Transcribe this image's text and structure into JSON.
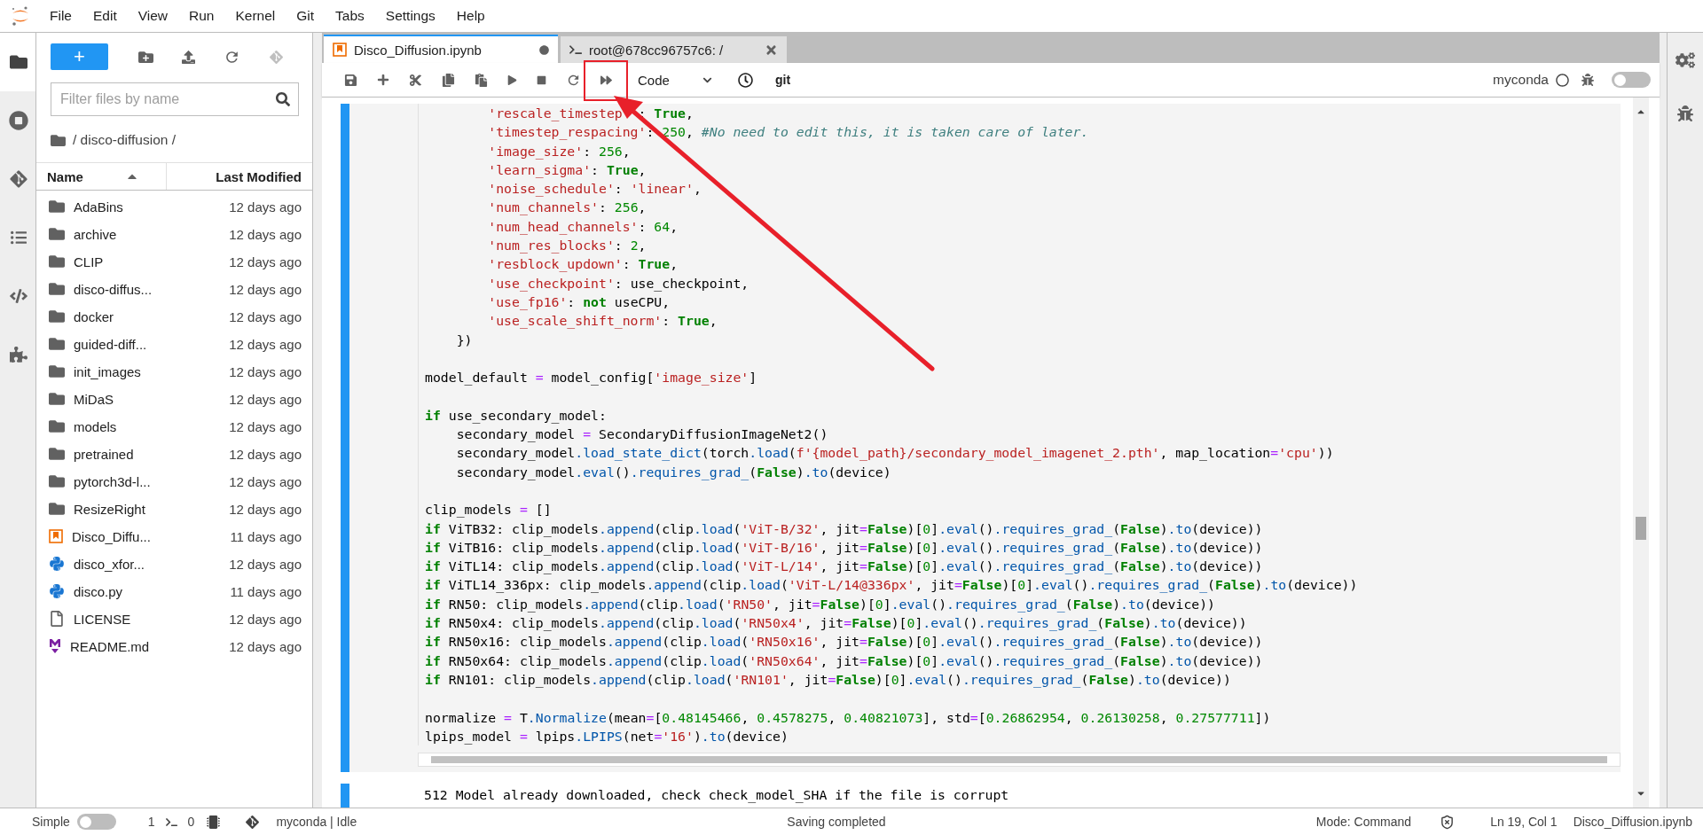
{
  "menu": [
    "File",
    "Edit",
    "View",
    "Run",
    "Kernel",
    "Git",
    "Tabs",
    "Settings",
    "Help"
  ],
  "left_rail": [
    {
      "kind": "files",
      "selected": true
    },
    {
      "kind": "running",
      "selected": false
    },
    {
      "kind": "git",
      "selected": false
    },
    {
      "kind": "toc",
      "selected": false
    },
    {
      "kind": "snippets",
      "selected": false
    },
    {
      "kind": "extensions",
      "selected": false
    }
  ],
  "file_browser": {
    "new_label": "+",
    "filter_placeholder": "Filter files by name",
    "path": "/ disco-diffusion /",
    "columns": [
      {
        "label": "Name",
        "sorted": true
      },
      {
        "label": "Last Modified",
        "sorted": false
      }
    ],
    "files": [
      {
        "name": "AdaBins",
        "modified": "12 days ago",
        "kind": "folder"
      },
      {
        "name": "archive",
        "modified": "12 days ago",
        "kind": "folder"
      },
      {
        "name": "CLIP",
        "modified": "12 days ago",
        "kind": "folder"
      },
      {
        "name": "disco-diffus...",
        "modified": "12 days ago",
        "kind": "folder"
      },
      {
        "name": "docker",
        "modified": "12 days ago",
        "kind": "folder"
      },
      {
        "name": "guided-diff...",
        "modified": "12 days ago",
        "kind": "folder"
      },
      {
        "name": "init_images",
        "modified": "12 days ago",
        "kind": "folder"
      },
      {
        "name": "MiDaS",
        "modified": "12 days ago",
        "kind": "folder"
      },
      {
        "name": "models",
        "modified": "12 days ago",
        "kind": "folder"
      },
      {
        "name": "pretrained",
        "modified": "12 days ago",
        "kind": "folder"
      },
      {
        "name": "pytorch3d-l...",
        "modified": "12 days ago",
        "kind": "folder"
      },
      {
        "name": "ResizeRight",
        "modified": "12 days ago",
        "kind": "folder"
      },
      {
        "name": "Disco_Diffu...",
        "modified": "11 days ago",
        "kind": "notebook"
      },
      {
        "name": "disco_xfor...",
        "modified": "12 days ago",
        "kind": "python"
      },
      {
        "name": "disco.py",
        "modified": "11 days ago",
        "kind": "python"
      },
      {
        "name": "LICENSE",
        "modified": "12 days ago",
        "kind": "file"
      },
      {
        "name": "README.md",
        "modified": "12 days ago",
        "kind": "markdown"
      }
    ]
  },
  "tabs": [
    {
      "label": "Disco_Diffusion.ipynb",
      "kind": "notebook",
      "selected": true,
      "dirty": true
    },
    {
      "label": "root@678cc96757c6: /",
      "kind": "terminal",
      "selected": false,
      "dirty": false
    }
  ],
  "toolbar": {
    "cell_type": "Code",
    "git": "git",
    "kernel": "myconda",
    "kernel_idle": true,
    "debugger_on": false
  },
  "code_lines": [
    {
      "kind": "code",
      "tokens": [
        {
          "kind": "string",
          "text": "        'rescale_timestep"
        },
        {
          "kind": "covered"
        },
        {
          "kind": "plain",
          "text": ": "
        },
        {
          "kind": "keyword",
          "text": "True"
        },
        {
          "kind": "plain",
          "text": ","
        }
      ]
    },
    {
      "kind": "code",
      "tokens": [
        {
          "kind": "string",
          "text": "        'timestep_respacing'"
        },
        {
          "kind": "plain",
          "text": ": "
        },
        {
          "kind": "number",
          "text": "250"
        },
        {
          "kind": "plain",
          "text": ", "
        },
        {
          "kind": "comment",
          "text": "#No need to edit this, it is taken care of later."
        }
      ]
    },
    {
      "kind": "code",
      "tokens": [
        {
          "kind": "string",
          "text": "        'image_size'"
        },
        {
          "kind": "plain",
          "text": ": "
        },
        {
          "kind": "number",
          "text": "256"
        },
        {
          "kind": "plain",
          "text": ","
        }
      ]
    },
    {
      "kind": "code",
      "tokens": [
        {
          "kind": "string",
          "text": "        'learn_sigma'"
        },
        {
          "kind": "plain",
          "text": ": "
        },
        {
          "kind": "keyword",
          "text": "True"
        },
        {
          "kind": "plain",
          "text": ","
        }
      ]
    },
    {
      "kind": "code",
      "tokens": [
        {
          "kind": "string",
          "text": "        'noise_schedule'"
        },
        {
          "kind": "plain",
          "text": ": "
        },
        {
          "kind": "string",
          "text": "'linear'"
        },
        {
          "kind": "plain",
          "text": ","
        }
      ]
    },
    {
      "kind": "code",
      "tokens": [
        {
          "kind": "string",
          "text": "        'num_channels'"
        },
        {
          "kind": "plain",
          "text": ": "
        },
        {
          "kind": "number",
          "text": "256"
        },
        {
          "kind": "plain",
          "text": ","
        }
      ]
    },
    {
      "kind": "code",
      "tokens": [
        {
          "kind": "string",
          "text": "        'num_head_channels'"
        },
        {
          "kind": "plain",
          "text": ": "
        },
        {
          "kind": "number",
          "text": "64"
        },
        {
          "kind": "plain",
          "text": ","
        }
      ]
    },
    {
      "kind": "code",
      "tokens": [
        {
          "kind": "string",
          "text": "        'num_res_blocks'"
        },
        {
          "kind": "plain",
          "text": ": "
        },
        {
          "kind": "number",
          "text": "2"
        },
        {
          "kind": "plain",
          "text": ","
        }
      ]
    },
    {
      "kind": "code",
      "tokens": [
        {
          "kind": "string",
          "text": "        'resblock_updown'"
        },
        {
          "kind": "plain",
          "text": ": "
        },
        {
          "kind": "keyword",
          "text": "True"
        },
        {
          "kind": "plain",
          "text": ","
        }
      ]
    },
    {
      "kind": "code",
      "tokens": [
        {
          "kind": "string",
          "text": "        'use_checkpoint'"
        },
        {
          "kind": "plain",
          "text": ": use_checkpoint,"
        }
      ]
    },
    {
      "kind": "code",
      "tokens": [
        {
          "kind": "string",
          "text": "        'use_fp16'"
        },
        {
          "kind": "plain",
          "text": ": "
        },
        {
          "kind": "keyword",
          "text": "not"
        },
        {
          "kind": "plain",
          "text": " useCPU,"
        }
      ]
    },
    {
      "kind": "code",
      "tokens": [
        {
          "kind": "string",
          "text": "        'use_scale_shift_norm'"
        },
        {
          "kind": "plain",
          "text": ": "
        },
        {
          "kind": "keyword",
          "text": "True"
        },
        {
          "kind": "plain",
          "text": ","
        }
      ]
    },
    {
      "kind": "code",
      "tokens": [
        {
          "kind": "plain",
          "text": "    })"
        }
      ]
    },
    {
      "kind": "blank"
    },
    {
      "kind": "code",
      "tokens": [
        {
          "kind": "plain",
          "text": "model_default "
        },
        {
          "kind": "operator",
          "text": "="
        },
        {
          "kind": "plain",
          "text": " model_config["
        },
        {
          "kind": "string",
          "text": "'image_size'"
        },
        {
          "kind": "plain",
          "text": "]"
        }
      ]
    },
    {
      "kind": "blank"
    },
    {
      "kind": "code",
      "tokens": [
        {
          "kind": "keyword",
          "text": "if"
        },
        {
          "kind": "plain",
          "text": " use_secondary_model:"
        }
      ]
    },
    {
      "kind": "code",
      "tokens": [
        {
          "kind": "plain",
          "text": "    secondary_model "
        },
        {
          "kind": "operator",
          "text": "="
        },
        {
          "kind": "plain",
          "text": " SecondaryDiffusionImageNet2()"
        }
      ]
    },
    {
      "kind": "code",
      "tokens": [
        {
          "kind": "plain",
          "text": "    secondary_model"
        },
        {
          "kind": "attr",
          "text": ".load_state_dict"
        },
        {
          "kind": "plain",
          "text": "(torch"
        },
        {
          "kind": "attr",
          "text": ".load"
        },
        {
          "kind": "plain",
          "text": "("
        },
        {
          "kind": "string",
          "text": "f'{model_path}/secondary_model_imagenet_2.pth'"
        },
        {
          "kind": "plain",
          "text": ", map_location"
        },
        {
          "kind": "operator",
          "text": "="
        },
        {
          "kind": "string",
          "text": "'cpu'"
        },
        {
          "kind": "plain",
          "text": "))"
        }
      ]
    },
    {
      "kind": "code",
      "tokens": [
        {
          "kind": "plain",
          "text": "    secondary_model"
        },
        {
          "kind": "attr",
          "text": ".eval"
        },
        {
          "kind": "plain",
          "text": "()"
        },
        {
          "kind": "attr",
          "text": ".requires_grad_"
        },
        {
          "kind": "plain",
          "text": "("
        },
        {
          "kind": "keyword",
          "text": "False"
        },
        {
          "kind": "plain",
          "text": ")"
        },
        {
          "kind": "attr",
          "text": ".to"
        },
        {
          "kind": "plain",
          "text": "(device)"
        }
      ]
    },
    {
      "kind": "blank"
    },
    {
      "kind": "code",
      "tokens": [
        {
          "kind": "plain",
          "text": "clip_models "
        },
        {
          "kind": "operator",
          "text": "="
        },
        {
          "kind": "plain",
          "text": " []"
        }
      ]
    },
    {
      "kind": "code",
      "tokens": [
        {
          "kind": "keyword",
          "text": "if"
        },
        {
          "kind": "plain",
          "text": " ViTB32: clip_models"
        },
        {
          "kind": "attr",
          "text": ".append"
        },
        {
          "kind": "plain",
          "text": "(clip"
        },
        {
          "kind": "attr",
          "text": ".load"
        },
        {
          "kind": "plain",
          "text": "("
        },
        {
          "kind": "string",
          "text": "'ViT-B/32'"
        },
        {
          "kind": "plain",
          "text": ", jit"
        },
        {
          "kind": "operator",
          "text": "="
        },
        {
          "kind": "keyword",
          "text": "False"
        },
        {
          "kind": "plain",
          "text": ")["
        },
        {
          "kind": "number",
          "text": "0"
        },
        {
          "kind": "plain",
          "text": "]"
        },
        {
          "kind": "attr",
          "text": ".eval"
        },
        {
          "kind": "plain",
          "text": "()"
        },
        {
          "kind": "attr",
          "text": ".requires_grad_"
        },
        {
          "kind": "plain",
          "text": "("
        },
        {
          "kind": "keyword",
          "text": "False"
        },
        {
          "kind": "plain",
          "text": ")"
        },
        {
          "kind": "attr",
          "text": ".to"
        },
        {
          "kind": "plain",
          "text": "(device))"
        }
      ]
    },
    {
      "kind": "code",
      "tokens": [
        {
          "kind": "keyword",
          "text": "if"
        },
        {
          "kind": "plain",
          "text": " ViTB16: clip_models"
        },
        {
          "kind": "attr",
          "text": ".append"
        },
        {
          "kind": "plain",
          "text": "(clip"
        },
        {
          "kind": "attr",
          "text": ".load"
        },
        {
          "kind": "plain",
          "text": "("
        },
        {
          "kind": "string",
          "text": "'ViT-B/16'"
        },
        {
          "kind": "plain",
          "text": ", jit"
        },
        {
          "kind": "operator",
          "text": "="
        },
        {
          "kind": "keyword",
          "text": "False"
        },
        {
          "kind": "plain",
          "text": ")["
        },
        {
          "kind": "number",
          "text": "0"
        },
        {
          "kind": "plain",
          "text": "]"
        },
        {
          "kind": "attr",
          "text": ".eval"
        },
        {
          "kind": "plain",
          "text": "()"
        },
        {
          "kind": "attr",
          "text": ".requires_grad_"
        },
        {
          "kind": "plain",
          "text": "("
        },
        {
          "kind": "keyword",
          "text": "False"
        },
        {
          "kind": "plain",
          "text": ")"
        },
        {
          "kind": "attr",
          "text": ".to"
        },
        {
          "kind": "plain",
          "text": "(device))"
        }
      ]
    },
    {
      "kind": "code",
      "tokens": [
        {
          "kind": "keyword",
          "text": "if"
        },
        {
          "kind": "plain",
          "text": " ViTL14: clip_models"
        },
        {
          "kind": "attr",
          "text": ".append"
        },
        {
          "kind": "plain",
          "text": "(clip"
        },
        {
          "kind": "attr",
          "text": ".load"
        },
        {
          "kind": "plain",
          "text": "("
        },
        {
          "kind": "string",
          "text": "'ViT-L/14'"
        },
        {
          "kind": "plain",
          "text": ", jit"
        },
        {
          "kind": "operator",
          "text": "="
        },
        {
          "kind": "keyword",
          "text": "False"
        },
        {
          "kind": "plain",
          "text": ")["
        },
        {
          "kind": "number",
          "text": "0"
        },
        {
          "kind": "plain",
          "text": "]"
        },
        {
          "kind": "attr",
          "text": ".eval"
        },
        {
          "kind": "plain",
          "text": "()"
        },
        {
          "kind": "attr",
          "text": ".requires_grad_"
        },
        {
          "kind": "plain",
          "text": "("
        },
        {
          "kind": "keyword",
          "text": "False"
        },
        {
          "kind": "plain",
          "text": ")"
        },
        {
          "kind": "attr",
          "text": ".to"
        },
        {
          "kind": "plain",
          "text": "(device))"
        }
      ]
    },
    {
      "kind": "code",
      "tokens": [
        {
          "kind": "keyword",
          "text": "if"
        },
        {
          "kind": "plain",
          "text": " ViTL14_336px: clip_models"
        },
        {
          "kind": "attr",
          "text": ".append"
        },
        {
          "kind": "plain",
          "text": "(clip"
        },
        {
          "kind": "attr",
          "text": ".load"
        },
        {
          "kind": "plain",
          "text": "("
        },
        {
          "kind": "string",
          "text": "'ViT-L/14@336px'"
        },
        {
          "kind": "plain",
          "text": ", jit"
        },
        {
          "kind": "operator",
          "text": "="
        },
        {
          "kind": "keyword",
          "text": "False"
        },
        {
          "kind": "plain",
          "text": ")["
        },
        {
          "kind": "number",
          "text": "0"
        },
        {
          "kind": "plain",
          "text": "]"
        },
        {
          "kind": "attr",
          "text": ".eval"
        },
        {
          "kind": "plain",
          "text": "()"
        },
        {
          "kind": "attr",
          "text": ".requires_grad_"
        },
        {
          "kind": "plain",
          "text": "("
        },
        {
          "kind": "keyword",
          "text": "False"
        },
        {
          "kind": "plain",
          "text": ")"
        },
        {
          "kind": "attr",
          "text": ".to"
        },
        {
          "kind": "plain",
          "text": "(device))"
        }
      ]
    },
    {
      "kind": "code",
      "tokens": [
        {
          "kind": "keyword",
          "text": "if"
        },
        {
          "kind": "plain",
          "text": " RN50: clip_models"
        },
        {
          "kind": "attr",
          "text": ".append"
        },
        {
          "kind": "plain",
          "text": "(clip"
        },
        {
          "kind": "attr",
          "text": ".load"
        },
        {
          "kind": "plain",
          "text": "("
        },
        {
          "kind": "string",
          "text": "'RN50'"
        },
        {
          "kind": "plain",
          "text": ", jit"
        },
        {
          "kind": "operator",
          "text": "="
        },
        {
          "kind": "keyword",
          "text": "False"
        },
        {
          "kind": "plain",
          "text": ")["
        },
        {
          "kind": "number",
          "text": "0"
        },
        {
          "kind": "plain",
          "text": "]"
        },
        {
          "kind": "attr",
          "text": ".eval"
        },
        {
          "kind": "plain",
          "text": "()"
        },
        {
          "kind": "attr",
          "text": ".requires_grad_"
        },
        {
          "kind": "plain",
          "text": "("
        },
        {
          "kind": "keyword",
          "text": "False"
        },
        {
          "kind": "plain",
          "text": ")"
        },
        {
          "kind": "attr",
          "text": ".to"
        },
        {
          "kind": "plain",
          "text": "(device))"
        }
      ]
    },
    {
      "kind": "code",
      "tokens": [
        {
          "kind": "keyword",
          "text": "if"
        },
        {
          "kind": "plain",
          "text": " RN50x4: clip_models"
        },
        {
          "kind": "attr",
          "text": ".append"
        },
        {
          "kind": "plain",
          "text": "(clip"
        },
        {
          "kind": "attr",
          "text": ".load"
        },
        {
          "kind": "plain",
          "text": "("
        },
        {
          "kind": "string",
          "text": "'RN50x4'"
        },
        {
          "kind": "plain",
          "text": ", jit"
        },
        {
          "kind": "operator",
          "text": "="
        },
        {
          "kind": "keyword",
          "text": "False"
        },
        {
          "kind": "plain",
          "text": ")["
        },
        {
          "kind": "number",
          "text": "0"
        },
        {
          "kind": "plain",
          "text": "]"
        },
        {
          "kind": "attr",
          "text": ".eval"
        },
        {
          "kind": "plain",
          "text": "()"
        },
        {
          "kind": "attr",
          "text": ".requires_grad_"
        },
        {
          "kind": "plain",
          "text": "("
        },
        {
          "kind": "keyword",
          "text": "False"
        },
        {
          "kind": "plain",
          "text": ")"
        },
        {
          "kind": "attr",
          "text": ".to"
        },
        {
          "kind": "plain",
          "text": "(device))"
        }
      ]
    },
    {
      "kind": "code",
      "tokens": [
        {
          "kind": "keyword",
          "text": "if"
        },
        {
          "kind": "plain",
          "text": " RN50x16: clip_models"
        },
        {
          "kind": "attr",
          "text": ".append"
        },
        {
          "kind": "plain",
          "text": "(clip"
        },
        {
          "kind": "attr",
          "text": ".load"
        },
        {
          "kind": "plain",
          "text": "("
        },
        {
          "kind": "string",
          "text": "'RN50x16'"
        },
        {
          "kind": "plain",
          "text": ", jit"
        },
        {
          "kind": "operator",
          "text": "="
        },
        {
          "kind": "keyword",
          "text": "False"
        },
        {
          "kind": "plain",
          "text": ")["
        },
        {
          "kind": "number",
          "text": "0"
        },
        {
          "kind": "plain",
          "text": "]"
        },
        {
          "kind": "attr",
          "text": ".eval"
        },
        {
          "kind": "plain",
          "text": "()"
        },
        {
          "kind": "attr",
          "text": ".requires_grad_"
        },
        {
          "kind": "plain",
          "text": "("
        },
        {
          "kind": "keyword",
          "text": "False"
        },
        {
          "kind": "plain",
          "text": ")"
        },
        {
          "kind": "attr",
          "text": ".to"
        },
        {
          "kind": "plain",
          "text": "(device))"
        }
      ]
    },
    {
      "kind": "code",
      "tokens": [
        {
          "kind": "keyword",
          "text": "if"
        },
        {
          "kind": "plain",
          "text": " RN50x64: clip_models"
        },
        {
          "kind": "attr",
          "text": ".append"
        },
        {
          "kind": "plain",
          "text": "(clip"
        },
        {
          "kind": "attr",
          "text": ".load"
        },
        {
          "kind": "plain",
          "text": "("
        },
        {
          "kind": "string",
          "text": "'RN50x64'"
        },
        {
          "kind": "plain",
          "text": ", jit"
        },
        {
          "kind": "operator",
          "text": "="
        },
        {
          "kind": "keyword",
          "text": "False"
        },
        {
          "kind": "plain",
          "text": ")["
        },
        {
          "kind": "number",
          "text": "0"
        },
        {
          "kind": "plain",
          "text": "]"
        },
        {
          "kind": "attr",
          "text": ".eval"
        },
        {
          "kind": "plain",
          "text": "()"
        },
        {
          "kind": "attr",
          "text": ".requires_grad_"
        },
        {
          "kind": "plain",
          "text": "("
        },
        {
          "kind": "keyword",
          "text": "False"
        },
        {
          "kind": "plain",
          "text": ")"
        },
        {
          "kind": "attr",
          "text": ".to"
        },
        {
          "kind": "plain",
          "text": "(device))"
        }
      ]
    },
    {
      "kind": "code",
      "tokens": [
        {
          "kind": "keyword",
          "text": "if"
        },
        {
          "kind": "plain",
          "text": " RN101: clip_models"
        },
        {
          "kind": "attr",
          "text": ".append"
        },
        {
          "kind": "plain",
          "text": "(clip"
        },
        {
          "kind": "attr",
          "text": ".load"
        },
        {
          "kind": "plain",
          "text": "("
        },
        {
          "kind": "string",
          "text": "'RN101'"
        },
        {
          "kind": "plain",
          "text": ", jit"
        },
        {
          "kind": "operator",
          "text": "="
        },
        {
          "kind": "keyword",
          "text": "False"
        },
        {
          "kind": "plain",
          "text": ")["
        },
        {
          "kind": "number",
          "text": "0"
        },
        {
          "kind": "plain",
          "text": "]"
        },
        {
          "kind": "attr",
          "text": ".eval"
        },
        {
          "kind": "plain",
          "text": "()"
        },
        {
          "kind": "attr",
          "text": ".requires_grad_"
        },
        {
          "kind": "plain",
          "text": "("
        },
        {
          "kind": "keyword",
          "text": "False"
        },
        {
          "kind": "plain",
          "text": ")"
        },
        {
          "kind": "attr",
          "text": ".to"
        },
        {
          "kind": "plain",
          "text": "(device))"
        }
      ]
    },
    {
      "kind": "blank"
    },
    {
      "kind": "code",
      "tokens": [
        {
          "kind": "plain",
          "text": "normalize "
        },
        {
          "kind": "operator",
          "text": "="
        },
        {
          "kind": "plain",
          "text": " T"
        },
        {
          "kind": "attr",
          "text": ".Normalize"
        },
        {
          "kind": "plain",
          "text": "(mean"
        },
        {
          "kind": "operator",
          "text": "="
        },
        {
          "kind": "plain",
          "text": "["
        },
        {
          "kind": "number",
          "text": "0.48145466"
        },
        {
          "kind": "plain",
          "text": ", "
        },
        {
          "kind": "number",
          "text": "0.4578275"
        },
        {
          "kind": "plain",
          "text": ", "
        },
        {
          "kind": "number",
          "text": "0.40821073"
        },
        {
          "kind": "plain",
          "text": "], std"
        },
        {
          "kind": "operator",
          "text": "="
        },
        {
          "kind": "plain",
          "text": "["
        },
        {
          "kind": "number",
          "text": "0.26862954"
        },
        {
          "kind": "plain",
          "text": ", "
        },
        {
          "kind": "number",
          "text": "0.26130258"
        },
        {
          "kind": "plain",
          "text": ", "
        },
        {
          "kind": "number",
          "text": "0.27577711"
        },
        {
          "kind": "plain",
          "text": "])"
        }
      ]
    },
    {
      "kind": "code",
      "tokens": [
        {
          "kind": "plain",
          "text": "lpips_model "
        },
        {
          "kind": "operator",
          "text": "="
        },
        {
          "kind": "plain",
          "text": " lpips"
        },
        {
          "kind": "attr",
          "text": ".LPIPS"
        },
        {
          "kind": "plain",
          "text": "(net"
        },
        {
          "kind": "operator",
          "text": "="
        },
        {
          "kind": "string",
          "text": "'16'"
        },
        {
          "kind": "plain",
          "text": ")"
        },
        {
          "kind": "attr",
          "text": ".to"
        },
        {
          "kind": "plain",
          "text": "(device)"
        }
      ]
    }
  ],
  "output_lines": [
    "512 Model already downloaded, check check_model_SHA if the file is corrupt"
  ],
  "status_bar": {
    "mode_label": "Simple",
    "simple_mode": false,
    "terminals": "1",
    "kernels": "0",
    "kernel_status": "myconda | Idle",
    "message": "Saving completed",
    "mode": "Mode: Command",
    "position": "Ln 19, Col 1",
    "file": "Disco_Diffusion.ipynb"
  }
}
